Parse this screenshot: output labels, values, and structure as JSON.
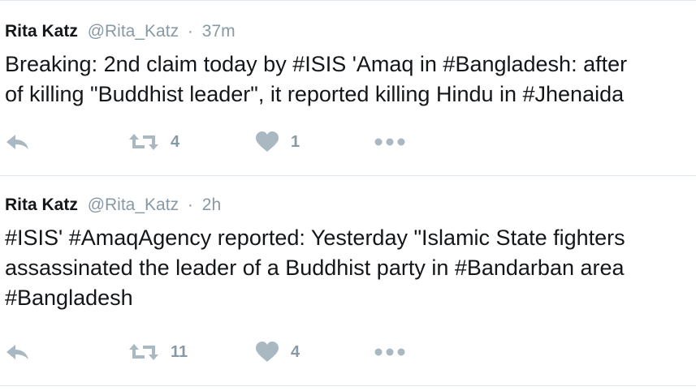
{
  "tweets": [
    {
      "name": "Rita Katz",
      "handle": "@Rita_Katz",
      "separator": "·",
      "time": "37m",
      "text": "Breaking: 2nd claim today by #ISIS 'Amaq in #Bangladesh: after\nof killing \"Buddhist leader\", it reported killing Hindu in #Jhenaida",
      "retweets": "4",
      "likes": "1"
    },
    {
      "name": "Rita Katz",
      "handle": "@Rita_Katz",
      "separator": "·",
      "time": "2h",
      "text": "#ISIS' #AmaqAgency reported: Yesterday \"Islamic State fighters\nassassinated the leader of a Buddhist party in #Bandarban area\n#Bangladesh",
      "retweets": "11",
      "likes": "4"
    }
  ],
  "icons": {
    "reply": "reply-icon",
    "retweet": "retweet-icon",
    "like": "heart-icon",
    "more": "more-dots-icon"
  },
  "colors": {
    "text": "#14171a",
    "muted": "#8899a6",
    "icon": "#aab8c2",
    "border": "#e1e8ed"
  }
}
